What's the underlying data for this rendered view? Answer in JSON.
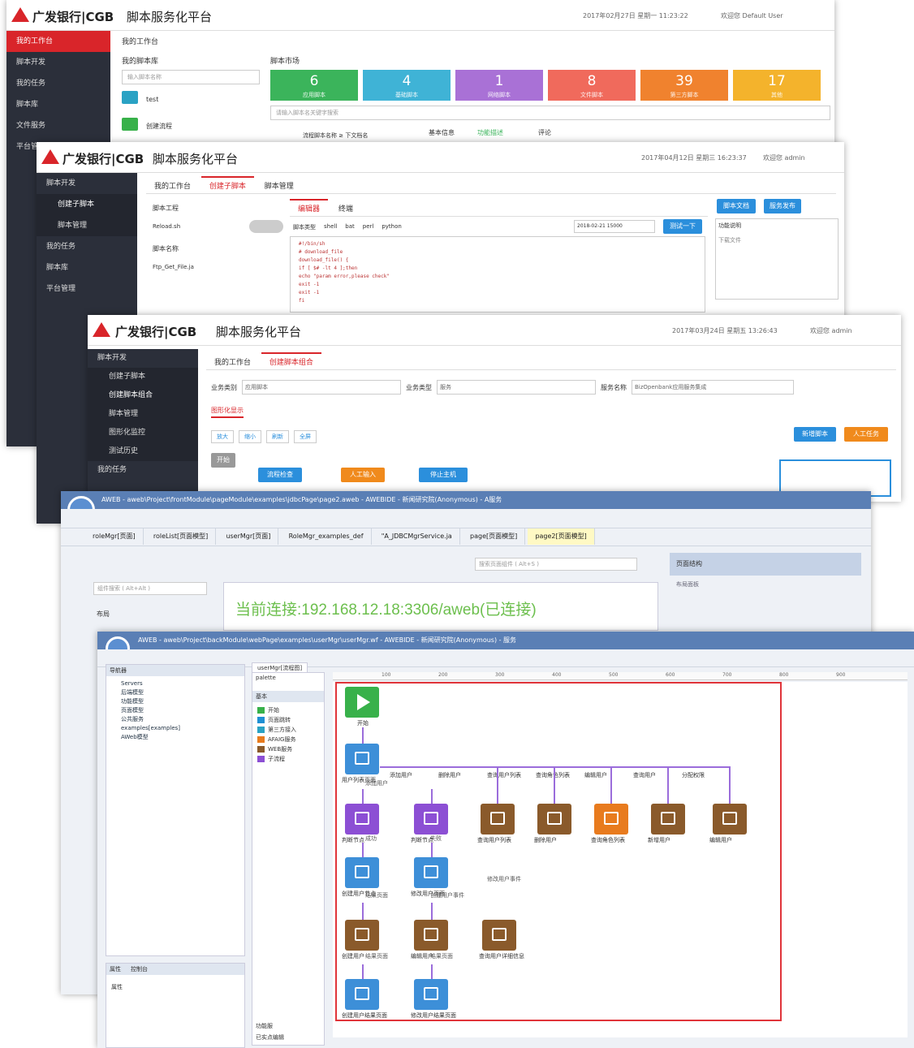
{
  "w1": {
    "brand": "广发银行|CGB",
    "title": "脚本服务化平台",
    "info": "2017年02月27日 星期一 11:23:22",
    "user": "欢迎您 Default User",
    "side": [
      "我的工作台",
      "脚本开发",
      "我的任务",
      "脚本库",
      "文件服务",
      "平台管理"
    ],
    "crumb": "我的工作台",
    "lib": "我的脚本库",
    "lib_search": "输入脚本名称",
    "lib_items": [
      "test",
      "创建流程"
    ],
    "market": "脚本市场",
    "search": "请输入脚本名关键字搜索",
    "tiles": [
      {
        "n": "6",
        "l": "应用脚本",
        "c": "#3bb45b"
      },
      {
        "n": "4",
        "l": "基础脚本",
        "c": "#3fb3d6"
      },
      {
        "n": "1",
        "l": "网络脚本",
        "c": "#a971d6"
      },
      {
        "n": "8",
        "l": "文件脚本",
        "c": "#f06a5c"
      },
      {
        "n": "39",
        "l": "第三方脚本",
        "c": "#f0822e"
      },
      {
        "n": "17",
        "l": "其他",
        "c": "#f4b32c"
      }
    ],
    "row": "流程脚本名称 ≥ 下文档名",
    "row_tabs": [
      "基本信息",
      "功能描述",
      "评论"
    ]
  },
  "w2": {
    "brand": "广发银行|CGB",
    "title": "脚本服务化平台",
    "info": "2017年04月12日 星期三 16:23:37",
    "user": "欢迎您 admin",
    "side": [
      "脚本开发",
      "创建子脚本",
      "脚本管理",
      "我的任务",
      "脚本库",
      "平台管理"
    ],
    "tabs": [
      "我的工作台",
      "创建子脚本",
      "脚本管理"
    ],
    "proj": "脚本工程",
    "file": "Reload.sh",
    "files_hdr": "脚本名称",
    "file2": "Ftp_Get_File.ja",
    "etabs": [
      "编辑器",
      "终端"
    ],
    "lang_label": "脚本类型",
    "langs": [
      "shell",
      "bat",
      "perl",
      "python"
    ],
    "date": "2018-02-21 15000",
    "test": "测试一下",
    "btns": [
      "脚本文档",
      "服务发布"
    ],
    "desc_hdr": "功能说明",
    "desc": "下载文件",
    "code": [
      "#!/bin/sh",
      "# download_file",
      "download_file() {",
      "  if [ $# -lt 4 ];then",
      "  echo \"param error,please check\"",
      "  exit -1",
      "  exit -1",
      "fi"
    ]
  },
  "w3": {
    "brand": "广发银行|CGB",
    "title": "脚本服务化平台",
    "info": "2017年03月24日 星期五 13:26:43",
    "user": "欢迎您 admin",
    "side": [
      "脚本开发",
      "创建子脚本",
      "创建脚本组合",
      "脚本管理",
      "图形化监控",
      "测试历史",
      "我的任务"
    ],
    "tabs": [
      "我的工作台",
      "创建脚本组合"
    ],
    "f1": "业务类别",
    "v1": "应用脚本",
    "f2": "业务类型",
    "v2": "服务",
    "f3": "服务名称",
    "v3": "BizOpenbank应用服务集成",
    "sec": "图形化显示",
    "zoom": [
      "放大",
      "缩小",
      "刷新",
      "全屏"
    ],
    "act": [
      "新增脚本",
      "人工任务"
    ],
    "nodes": [
      "开始",
      "流程检查",
      "人工输入",
      "停止主机"
    ]
  },
  "w4": {
    "title": "AWEB - aweb\\Project\\frontModule\\pageModule\\examples\\jdbcPage\\page2.aweb - AWEBIDE - 新闻研究院(Anonymous) - A服务",
    "etabs": [
      "roleMgr[页面]",
      "roleList[页面模型]",
      "userMgr[页面]",
      "RoleMgr_examples_def",
      "\"A_JDBCMgrService.ja",
      "page[页面模型]",
      "page2[页面模型]"
    ],
    "search": "搜索页面组件 ( Alt+S )",
    "left_search": "组件搜索 ( Alt+Alt )",
    "tree": "布局",
    "panel": "页面结构",
    "panel2": "布局面板",
    "conn": "当前连接:192.168.12.18:3306/aweb(已连接)"
  },
  "w5": {
    "title": "AWEB - aweb\\Project\\backModule\\webPage\\examples\\userMgr\\userMgr.wf - AWEBIDE - 新闻研究院(Anonymous) - 服务",
    "nav": "导航器",
    "servers": [
      "Servers",
      "后端模型",
      "功能模型",
      "页面模型",
      "公共服务",
      "examples[examples]",
      "AWeb模型"
    ],
    "etab": "userMgr[流程图]",
    "palette": "palette",
    "pal_hdr": "基本",
    "pal": [
      {
        "t": "开始",
        "c": "#38b14a"
      },
      {
        "t": "页面跳转",
        "c": "#1e90d4"
      },
      {
        "t": "第三方接入",
        "c": "#2aa2c4"
      },
      {
        "t": "AFAIG服务",
        "c": "#e87b1e"
      },
      {
        "t": "WEB服务",
        "c": "#8a5a2b"
      },
      {
        "t": "子流程",
        "c": "#8c4fd4"
      }
    ],
    "props": "属性",
    "props2": "控制台",
    "bottom": [
      "功能服",
      "已实点编辑"
    ],
    "ruler": [
      "100",
      "200",
      "300",
      "400",
      "500",
      "600",
      "700",
      "800",
      "900"
    ],
    "n_start": "开始",
    "n_list": "用户列表页面",
    "n_edges": [
      "添加用户",
      "删除用户",
      "查询用户列表",
      "查询角色列表",
      "编辑用户",
      "查询用户",
      "分配权限"
    ],
    "n_b": [
      "查询用户列表",
      "删除用户",
      "查询角色列表",
      "新增用户",
      "编辑用户"
    ],
    "n_sw": [
      "判断节点",
      "判断节点"
    ],
    "n_l2": [
      "创建用户节点",
      "修改用户页面"
    ],
    "n_l3": [
      "创建用户",
      "编辑用户",
      "查询用户详细信息"
    ],
    "n_l4": [
      "创建用户结果页面",
      "修改用户结果页面"
    ],
    "e_small": [
      "添加用户",
      "成功",
      "失败",
      "结果页面",
      "创建用户事件",
      "修改用户事件",
      "结果页面",
      "结果页面"
    ]
  }
}
